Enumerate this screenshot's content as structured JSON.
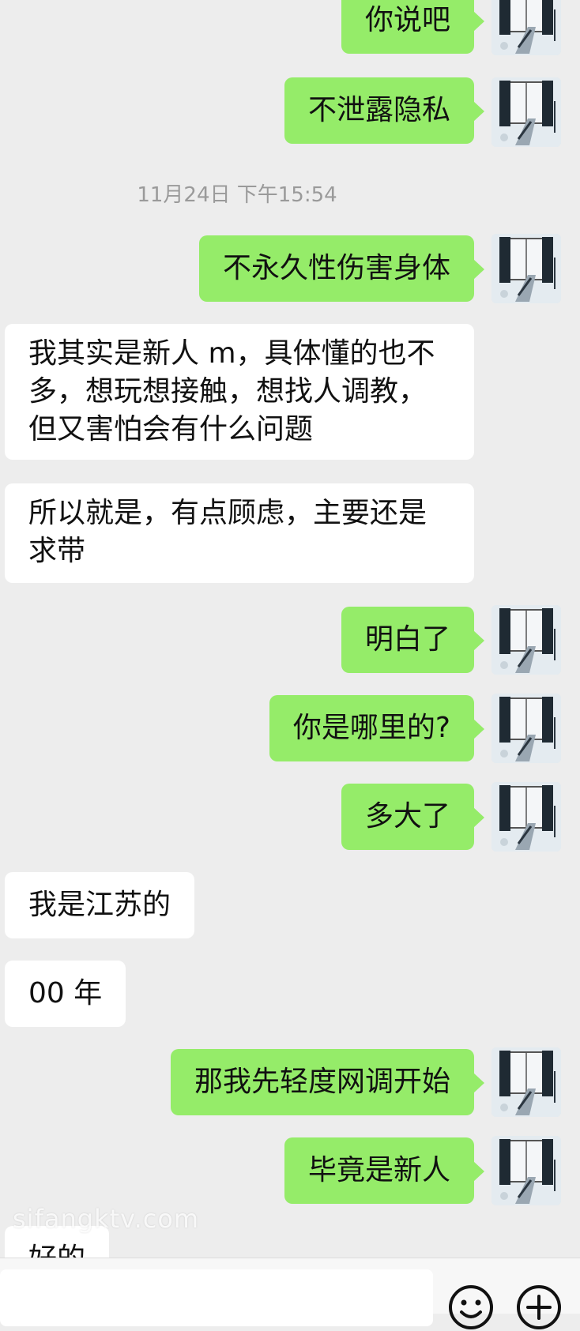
{
  "messages": [
    {
      "type": "out",
      "text": "你说吧"
    },
    {
      "type": "out",
      "text": "不泄露隐私"
    },
    {
      "type": "timestamp",
      "text": "11月24日 下午15:54"
    },
    {
      "type": "out",
      "text": "不永久性伤害身体"
    },
    {
      "type": "in",
      "text": "我其实是新人 m，具体懂的也不多，想玩想接触，想找人调教，但又害怕会有什么问题"
    },
    {
      "type": "in",
      "text": "所以就是，有点顾虑，主要还是求带"
    },
    {
      "type": "out",
      "text": "明白了"
    },
    {
      "type": "out",
      "text": "你是哪里的?"
    },
    {
      "type": "out",
      "text": "多大了"
    },
    {
      "type": "in",
      "text": "我是江苏的"
    },
    {
      "type": "in",
      "text": "00 年"
    },
    {
      "type": "out",
      "text": "那我先轻度网调开始"
    },
    {
      "type": "out",
      "text": "毕竟是新人"
    },
    {
      "type": "in",
      "text": "好的"
    }
  ],
  "watermark": "sifangktv.com",
  "input": {
    "value": ""
  },
  "icons": {
    "emoji": "emoji-icon",
    "add": "add-icon",
    "avatar": "user-avatar"
  },
  "colors": {
    "outgoing": "#95ec69",
    "incoming": "#ffffff",
    "background": "#ededed",
    "timestamp": "#9a9a9a"
  }
}
